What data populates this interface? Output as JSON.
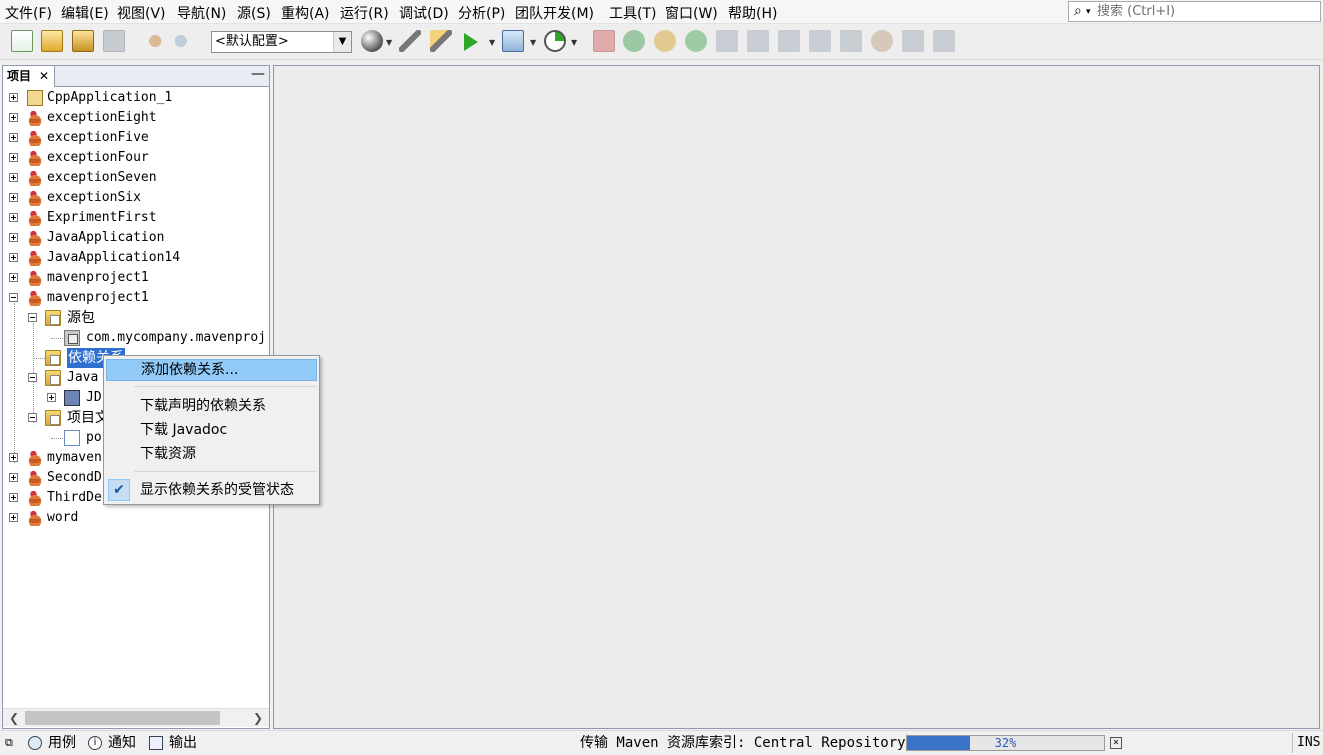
{
  "menubar": {
    "items": [
      "文件(F)",
      "编辑(E)",
      "视图(V)",
      "导航(N)",
      "源(S)",
      "重构(A)",
      "运行(R)",
      "调试(D)",
      "分析(P)",
      "团队开发(M)",
      "工具(T)",
      "窗口(W)",
      "帮助(H)"
    ],
    "search_placeholder": "搜索 (Ctrl+I)"
  },
  "toolbar": {
    "config_value": "<默认配置>",
    "icons": [
      "new-file-icon",
      "new-project-icon",
      "open-project-icon",
      "close-project-icon",
      "undo-icon",
      "redo-icon",
      "build-icon",
      "clean-build-icon",
      "run-icon",
      "debug-icon",
      "profile-icon"
    ]
  },
  "projects_panel": {
    "tab_label": "项目",
    "items": [
      {
        "label": "CppApplication_1",
        "type": "cpp",
        "expanded": false
      },
      {
        "label": "exceptionEight",
        "type": "java",
        "expanded": false
      },
      {
        "label": "exceptionFive",
        "type": "java",
        "expanded": false
      },
      {
        "label": "exceptionFour",
        "type": "java",
        "expanded": false
      },
      {
        "label": "exceptionSeven",
        "type": "java",
        "expanded": false
      },
      {
        "label": "exceptionSix",
        "type": "java",
        "expanded": false
      },
      {
        "label": "ExprimentFirst",
        "type": "java",
        "expanded": false
      },
      {
        "label": "JavaApplication",
        "type": "java",
        "expanded": false
      },
      {
        "label": "JavaApplication14",
        "type": "java",
        "expanded": false
      },
      {
        "label": "mavenproject1",
        "type": "maven",
        "expanded": false
      },
      {
        "label": "mavenproject1",
        "type": "maven",
        "expanded": true
      }
    ],
    "children": [
      {
        "label": "源包",
        "level": 1,
        "type": "folder"
      },
      {
        "label": "com.mycompany.mavenproj",
        "level": 2,
        "type": "package"
      },
      {
        "label": "依赖关系",
        "level": 1,
        "type": "folder",
        "selected": true
      },
      {
        "label": "Java",
        "level": 1,
        "type": "folder"
      },
      {
        "label": "JD",
        "level": 2,
        "type": "jdk"
      },
      {
        "label": "项目文",
        "level": 1,
        "type": "folder"
      },
      {
        "label": "po",
        "level": 2,
        "type": "pom"
      }
    ],
    "items_after": [
      {
        "label": "mymaven",
        "type": "maven"
      },
      {
        "label": "SecondD",
        "type": "java"
      },
      {
        "label": "ThirdDe",
        "type": "java"
      },
      {
        "label": "word",
        "type": "maven"
      }
    ]
  },
  "context_menu": {
    "items": [
      {
        "label": "添加依赖关系...",
        "highlighted": true
      },
      {
        "label": "下载声明的依赖关系"
      },
      {
        "label": "下载 Javadoc"
      },
      {
        "label": "下载资源"
      },
      {
        "label": "显示依赖关系的受管状态",
        "checked": true
      }
    ]
  },
  "statusbar": {
    "tabs": [
      {
        "label": "用例",
        "icon": "search-icon"
      },
      {
        "label": "通知",
        "icon": "info-icon"
      },
      {
        "label": "输出",
        "icon": "output-icon"
      }
    ],
    "task_text": "传输 Maven 资源库索引: Central Repository",
    "progress_percent": 32,
    "progress_label": "32%",
    "mode": "INS"
  }
}
